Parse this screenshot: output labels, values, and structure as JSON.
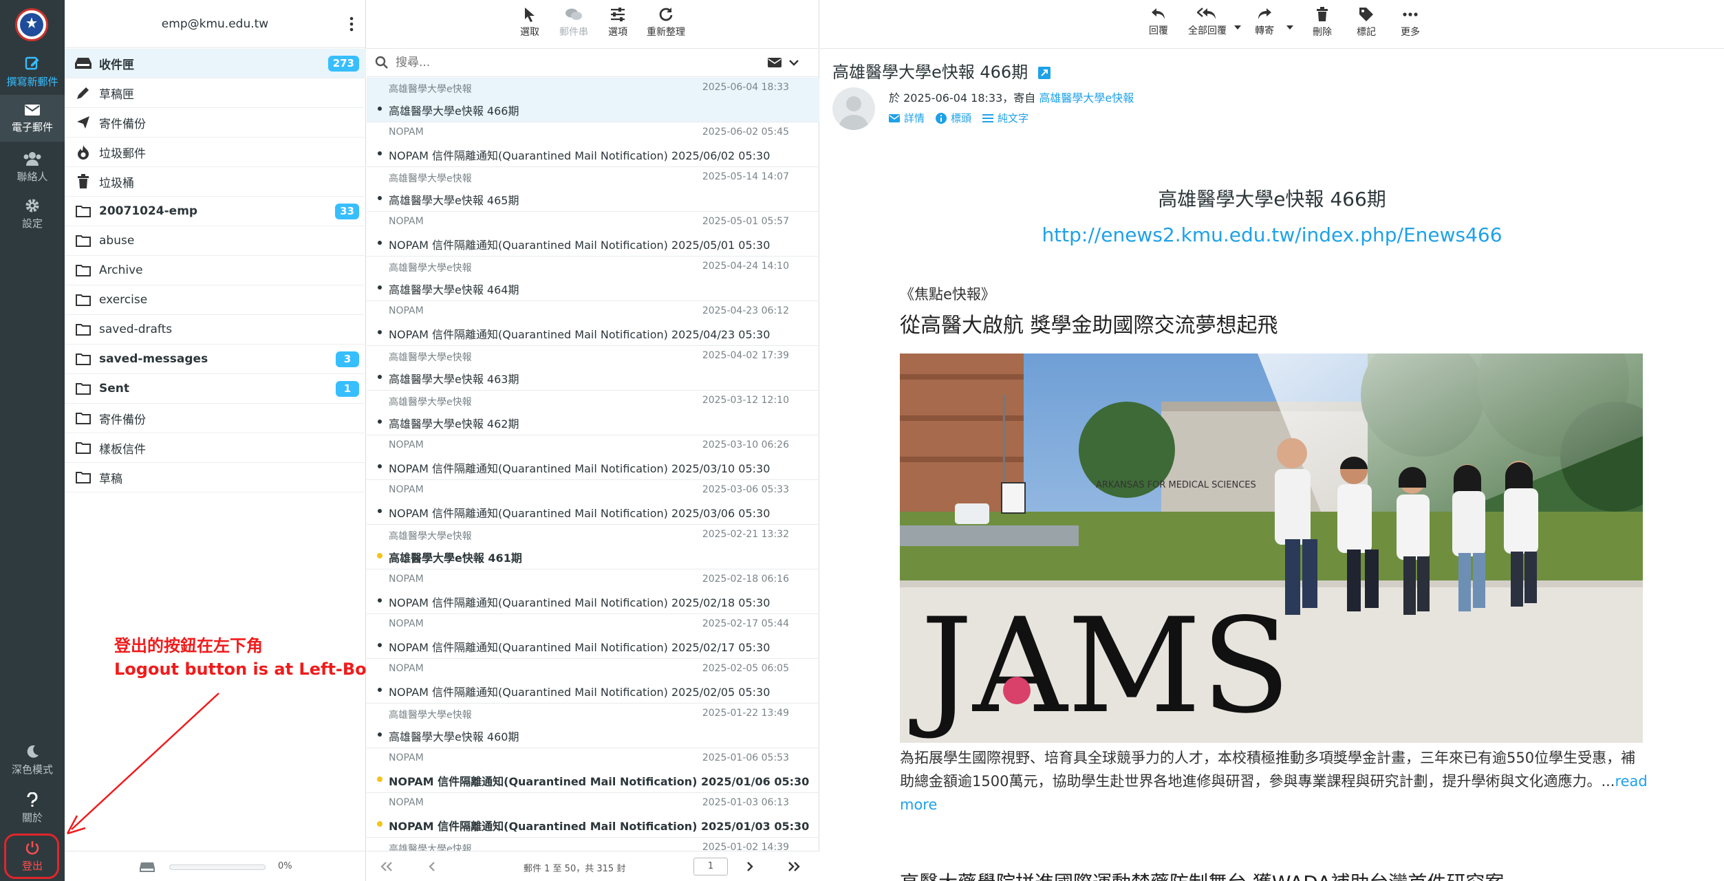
{
  "rail": {
    "compose": "撰寫新郵件",
    "mail": "電子郵件",
    "contacts": "聯絡人",
    "settings": "設定",
    "dark_mode": "深色模式",
    "about": "關於",
    "logout": "登出"
  },
  "account": "emp@kmu.edu.tw",
  "folders": [
    {
      "name": "收件匣",
      "count": "273",
      "icon": "inbox-icon"
    },
    {
      "name": "草稿匣",
      "count": "",
      "icon": "pencil-icon"
    },
    {
      "name": "寄件備份",
      "count": "",
      "icon": "send-icon"
    },
    {
      "name": "垃圾郵件",
      "count": "",
      "icon": "fire-icon"
    },
    {
      "name": "垃圾桶",
      "count": "",
      "icon": "trash-icon"
    },
    {
      "name": "20071024-emp",
      "count": "33",
      "icon": "folder-icon"
    },
    {
      "name": "abuse",
      "count": "",
      "icon": "folder-icon"
    },
    {
      "name": "Archive",
      "count": "",
      "icon": "folder-icon"
    },
    {
      "name": "exercise",
      "count": "",
      "icon": "folder-icon"
    },
    {
      "name": "saved-drafts",
      "count": "",
      "icon": "folder-icon"
    },
    {
      "name": "saved-messages",
      "count": "3",
      "icon": "folder-icon"
    },
    {
      "name": "Sent",
      "count": "1",
      "icon": "folder-icon"
    },
    {
      "name": "寄件備份",
      "count": "",
      "icon": "folder-icon"
    },
    {
      "name": "樣板信件",
      "count": "",
      "icon": "folder-icon"
    },
    {
      "name": "草稿",
      "count": "",
      "icon": "folder-icon"
    }
  ],
  "quota": {
    "percent_text": "0%",
    "fraction": 0.0
  },
  "annotation": {
    "line1": "登出的按鈕在左下角",
    "line2": "Logout button is at Left-Bottom"
  },
  "list_toolbar": {
    "select": "選取",
    "threads": "郵件串",
    "options": "選項",
    "refresh": "重新整理"
  },
  "search_placeholder": "搜尋...",
  "messages": [
    {
      "from": "高雄醫學大學e快報",
      "date": "2025-06-04 18:33",
      "subject": "高雄醫學大學e快報 466期",
      "unread": false
    },
    {
      "from": "NOPAM",
      "date": "2025-06-02 05:45",
      "subject": "NOPAM 信件隔離通知(Quarantined Mail Notification) 2025/06/02 05:30",
      "unread": false
    },
    {
      "from": "高雄醫學大學e快報",
      "date": "2025-05-14 14:07",
      "subject": "高雄醫學大學e快報 465期",
      "unread": false
    },
    {
      "from": "NOPAM",
      "date": "2025-05-01 05:57",
      "subject": "NOPAM 信件隔離通知(Quarantined Mail Notification) 2025/05/01 05:30",
      "unread": false
    },
    {
      "from": "高雄醫學大學e快報",
      "date": "2025-04-24 14:10",
      "subject": "高雄醫學大學e快報 464期",
      "unread": false
    },
    {
      "from": "NOPAM",
      "date": "2025-04-23 06:12",
      "subject": "NOPAM 信件隔離通知(Quarantined Mail Notification) 2025/04/23 05:30",
      "unread": false
    },
    {
      "from": "高雄醫學大學e快報",
      "date": "2025-04-02 17:39",
      "subject": "高雄醫學大學e快報 463期",
      "unread": false
    },
    {
      "from": "高雄醫學大學e快報",
      "date": "2025-03-12 12:10",
      "subject": "高雄醫學大學e快報 462期",
      "unread": false
    },
    {
      "from": "NOPAM",
      "date": "2025-03-10 06:26",
      "subject": "NOPAM 信件隔離通知(Quarantined Mail Notification) 2025/03/10 05:30",
      "unread": false
    },
    {
      "from": "NOPAM",
      "date": "2025-03-06 05:33",
      "subject": "NOPAM 信件隔離通知(Quarantined Mail Notification) 2025/03/06 05:30",
      "unread": false
    },
    {
      "from": "高雄醫學大學e快報",
      "date": "2025-02-21 13:32",
      "subject": "高雄醫學大學e快報 461期",
      "unread": true
    },
    {
      "from": "NOPAM",
      "date": "2025-02-18 06:16",
      "subject": "NOPAM 信件隔離通知(Quarantined Mail Notification) 2025/02/18 05:30",
      "unread": false
    },
    {
      "from": "NOPAM",
      "date": "2025-02-17 05:44",
      "subject": "NOPAM 信件隔離通知(Quarantined Mail Notification) 2025/02/17 05:30",
      "unread": false
    },
    {
      "from": "NOPAM",
      "date": "2025-02-05 06:05",
      "subject": "NOPAM 信件隔離通知(Quarantined Mail Notification) 2025/02/05 05:30",
      "unread": false
    },
    {
      "from": "高雄醫學大學e快報",
      "date": "2025-01-22 13:49",
      "subject": "高雄醫學大學e快報 460期",
      "unread": false
    },
    {
      "from": "NOPAM",
      "date": "2025-01-06 05:53",
      "subject": "NOPAM 信件隔離通知(Quarantined Mail Notification) 2025/01/06 05:30",
      "unread": true
    },
    {
      "from": "NOPAM",
      "date": "2025-01-03 06:13",
      "subject": "NOPAM 信件隔離通知(Quarantined Mail Notification) 2025/01/03 05:30",
      "unread": true
    },
    {
      "from": "高雄醫學大學e快報",
      "date": "2025-01-02 14:39",
      "subject": "",
      "unread": false
    }
  ],
  "pager": {
    "summary": "郵件 1 至 50，共 315 封",
    "page": "1"
  },
  "reader_toolbar": {
    "reply": "回覆",
    "reply_all": "全部回覆",
    "forward": "轉寄",
    "delete": "刪除",
    "mark": "標記",
    "more": "更多"
  },
  "reader": {
    "subject": "高雄醫學大學e快報 466期",
    "meta_prefix": "於 2025-06-04 18:33，寄自",
    "sender": "高雄醫學大學e快報",
    "link_details": "詳情",
    "link_headers": "標頭",
    "link_plain": "純文字"
  },
  "body": {
    "title": "高雄醫學大學e快報 466期",
    "url": "http://enews2.kmu.edu.tw/index.php/Enews466",
    "focus_tag": "《焦點e快報》",
    "headline": "從高醫大啟航 獎學金助國際交流夢想起飛",
    "photo_sign": "JAMS",
    "photo_banner": "ARKANSAS FOR MEDICAL SCIENCES",
    "paragraph": "為拓展學生國際視野、培育具全球競爭力的人才，本校積極推動多項獎學金計畫，三年來已有逾550位學生受惠，補助總金額逾1500萬元，協助學生赴世界各地進修與研習，參與專業課程與研究計劃，提升學術與文化適應力。...",
    "read_more": "read more",
    "headline2": "高醫大藥學院拼進國際運動禁藥防制舞台 獲WADA補助台灣首件研究案"
  },
  "colors": {
    "rail_bg": "#2f3a3f",
    "accent": "#37beff",
    "link": "#1ea1e8",
    "unread_dot": "#f5c317",
    "annotation_red": "#f01b1b"
  }
}
